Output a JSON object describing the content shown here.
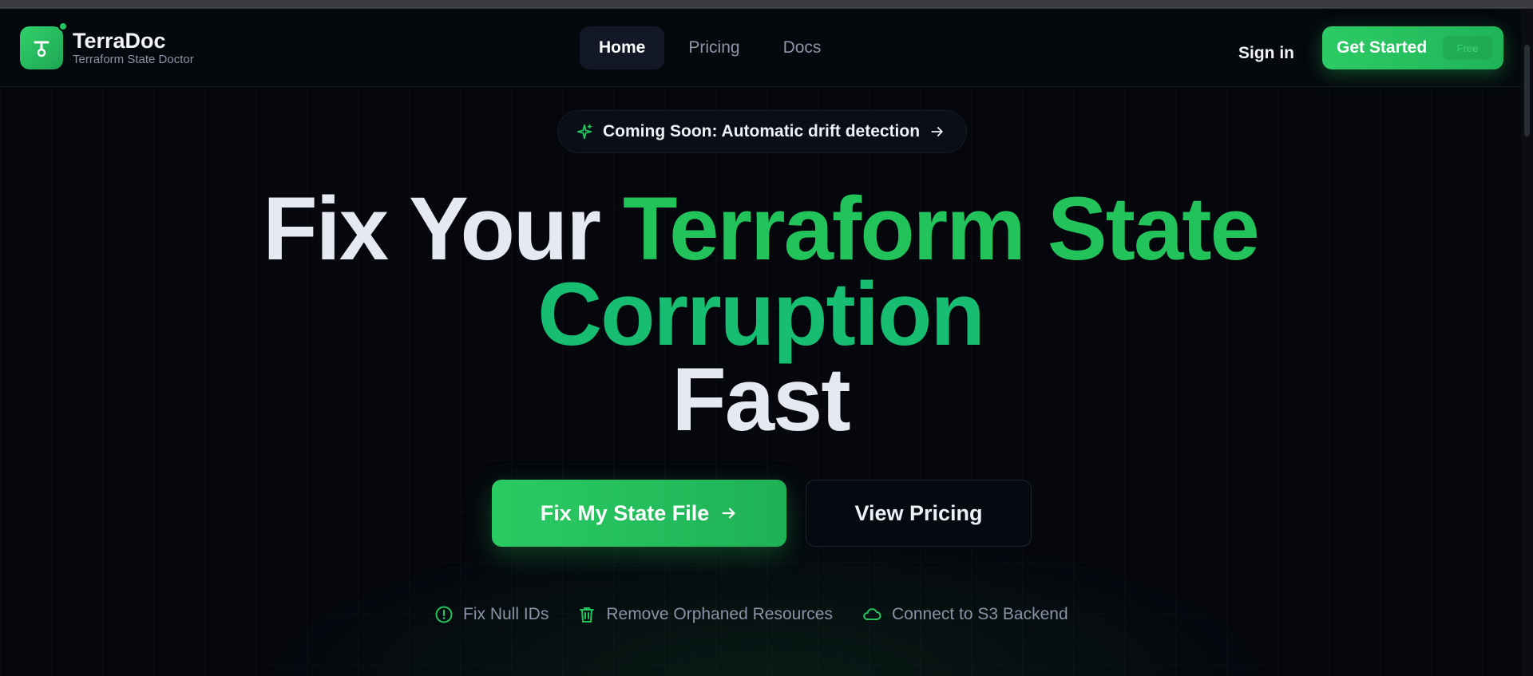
{
  "header": {
    "brand_name": "TerraDoc",
    "brand_tagline": "Terraform State Doctor",
    "nav": [
      {
        "label": "Home",
        "active": true
      },
      {
        "label": "Pricing",
        "active": false
      },
      {
        "label": "Docs",
        "active": false
      }
    ],
    "sign_in_label": "Sign in",
    "get_started_label": "Get Started",
    "get_started_badge": "Free"
  },
  "announcement": {
    "label": "Coming Soon: Automatic drift detection",
    "icon": "sparkle-icon",
    "arrow_icon": "arrow-right-icon"
  },
  "hero": {
    "headline_white_1": "Fix Your ",
    "headline_green_1": "Terraform State",
    "headline_green_2": "Corruption",
    "headline_white_2": "Fast"
  },
  "buttons": {
    "primary_label": "Fix My State File",
    "secondary_label": "View Pricing"
  },
  "features": [
    {
      "label": "Fix Null IDs",
      "icon": "alert-circle-icon"
    },
    {
      "label": "Remove Orphaned Resources",
      "icon": "trash-icon"
    },
    {
      "label": "Connect to S3 Backend",
      "icon": "cloud-icon"
    }
  ],
  "colors": {
    "accent": "#22c55e",
    "background": "#05070d",
    "text_muted": "#8a93a6"
  }
}
